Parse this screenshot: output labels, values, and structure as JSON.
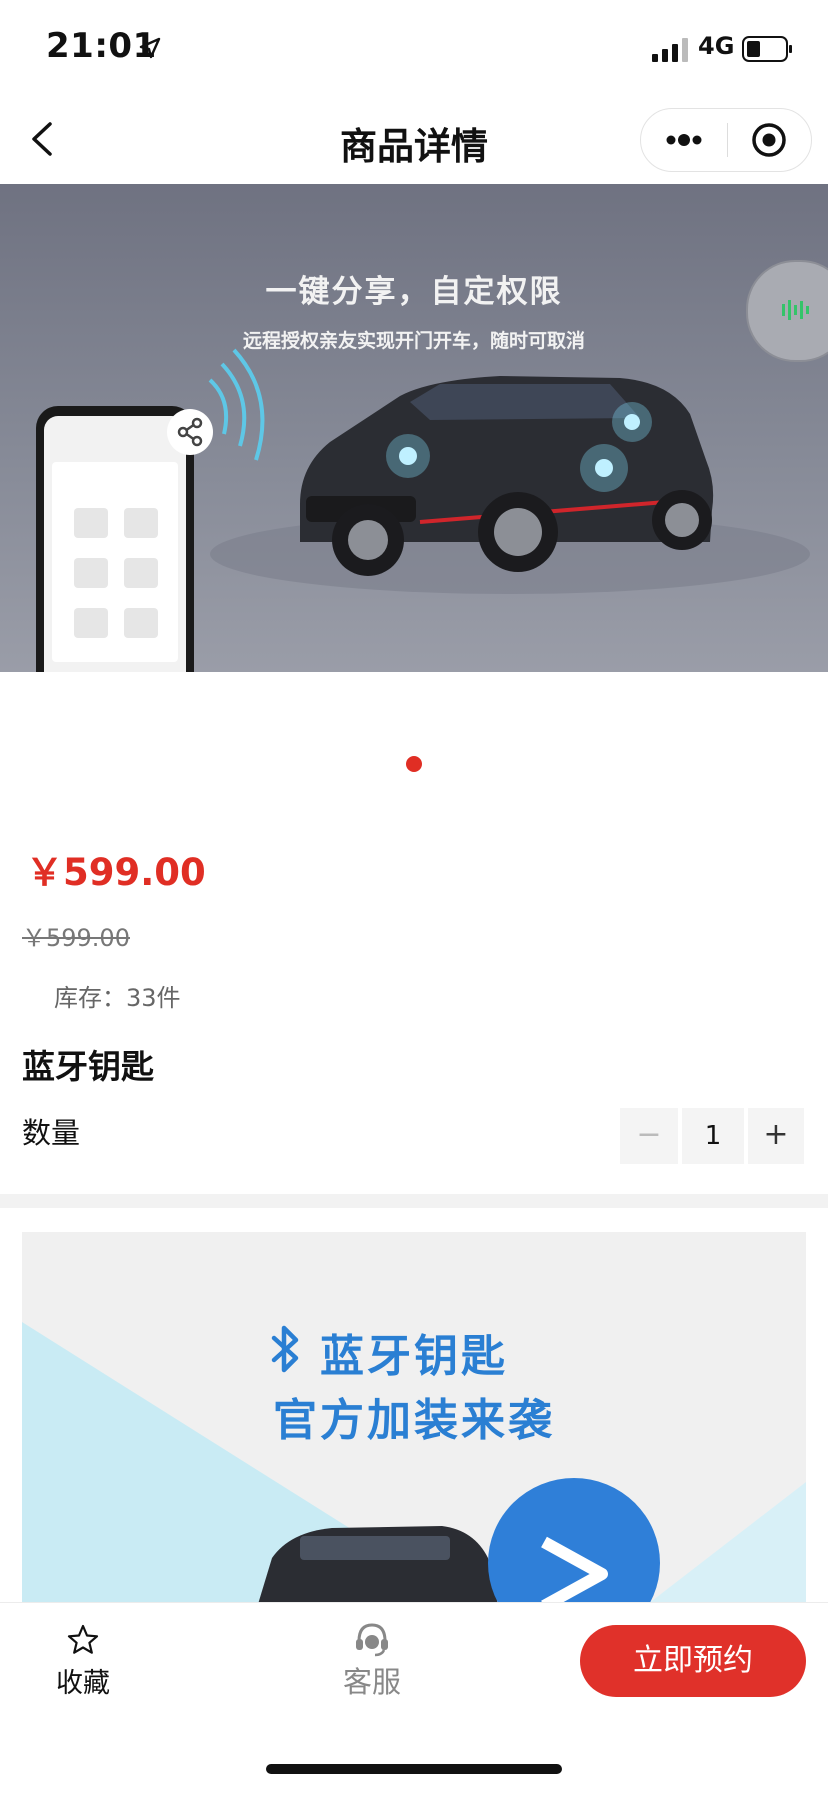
{
  "status_bar": {
    "time": "21:01",
    "network": "4G"
  },
  "nav": {
    "title": "商品详情"
  },
  "banner": {
    "headline": "一键分享，自定权限",
    "subline": "远程授权亲友实现开门开车，随时可取消",
    "slide_count": 1,
    "active_slide": 1
  },
  "product": {
    "price": "￥599.00",
    "original_price": "￥599.00",
    "stock": "库存：33件",
    "name": "蓝牙钥匙",
    "quantity_label": "数量",
    "quantity": "1",
    "minus_symbol": "−",
    "plus_symbol": "+"
  },
  "detail": {
    "title_line1": "蓝牙钥匙",
    "title_line2": "官方加装来袭"
  },
  "tab_bar": {
    "favorite_label": "收藏",
    "service_label": "客服",
    "book_label": "立即预约"
  },
  "colors": {
    "accent_red": "#e02e24",
    "button_red": "#e0312a",
    "detail_blue": "#2a7fd3",
    "banner_gray": "#868a97"
  },
  "icons": {
    "back": "chevron-left-icon",
    "more": "more-dots-icon",
    "close": "target-close-icon",
    "share": "share-icon",
    "favorite": "star-icon",
    "service": "headset-icon",
    "bluetooth": "bluetooth-icon"
  }
}
